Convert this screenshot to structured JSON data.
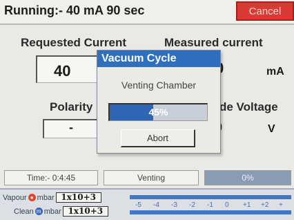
{
  "top": {
    "status_text": "Running:- 40 mA 90 sec",
    "cancel_label": "Cancel"
  },
  "main": {
    "requested_label": "Requested Current",
    "requested_value": "40",
    "measured_label": "Measured current",
    "measured_value_partial": "0",
    "measured_unit": "mA",
    "polarity_label": "Polarity",
    "polarity_value": "-",
    "voltage_label_partial": "de Voltage",
    "voltage_value_partial": "0",
    "voltage_unit": "V"
  },
  "dialog": {
    "title": "Vacuum Cycle",
    "message": "Venting Chamber",
    "progress_percent": 45,
    "progress_text": "45%",
    "abort_label": "Abort"
  },
  "status_row": {
    "time": "Time:- 0:4:45",
    "state": "Venting",
    "percent": "0%"
  },
  "gauges": {
    "vapour_label": "Vapour",
    "clean_label": "Clean",
    "unit": "mbar",
    "vapour_value": "1x10+3",
    "clean_value": "1x10+3",
    "ticks": [
      "-5",
      "-4",
      "-3",
      "-2",
      "-1",
      "0",
      "+1",
      "+2",
      "+"
    ]
  },
  "colors": {
    "cancel_bg": "#d93a34",
    "dialog_title_bg": "#2f6fc0",
    "progress_fill": "#2e65b5"
  }
}
